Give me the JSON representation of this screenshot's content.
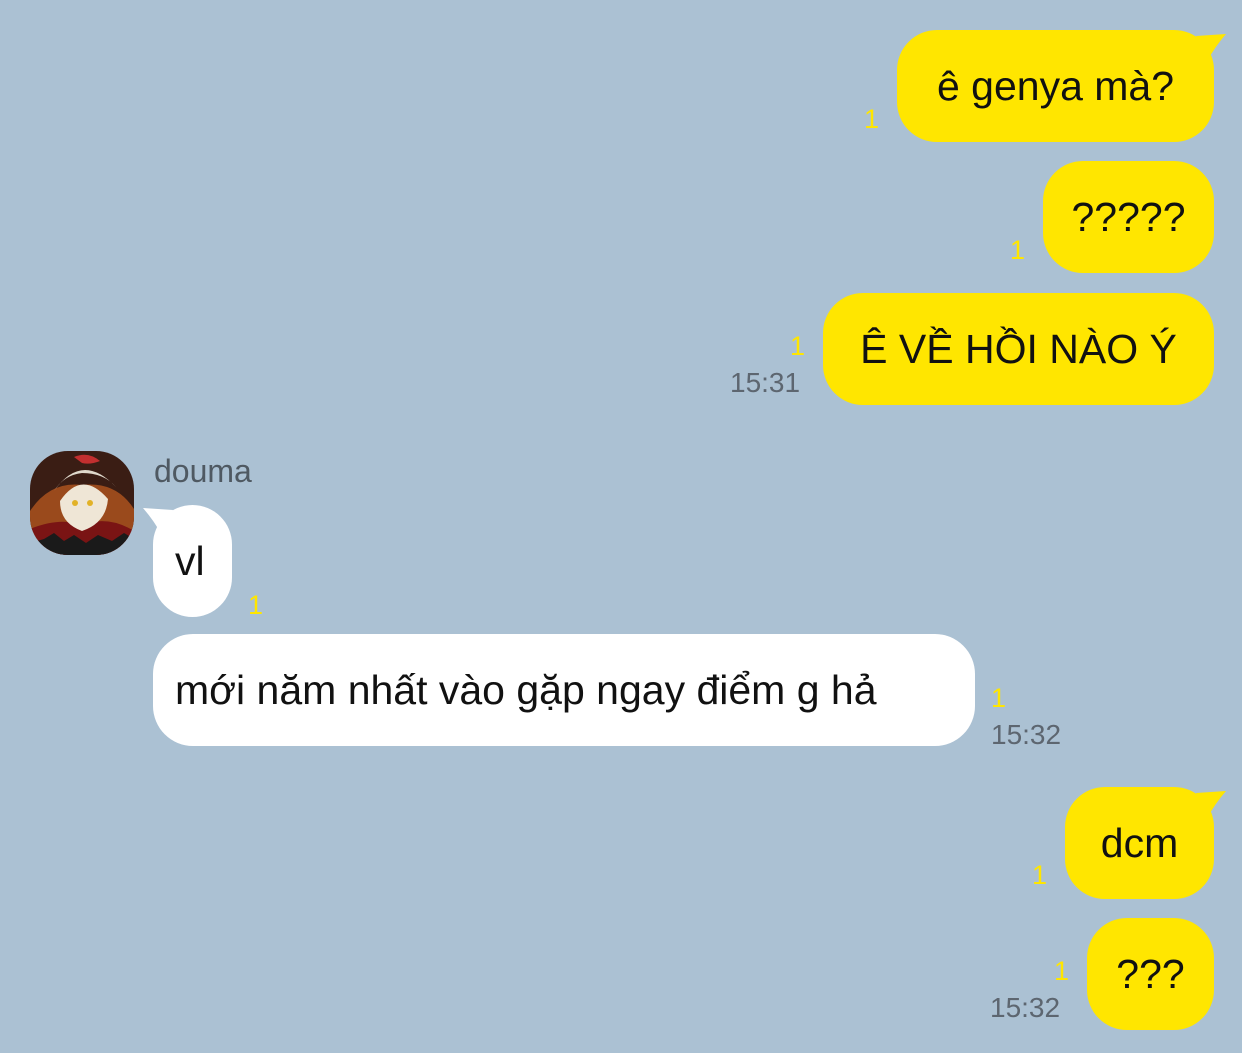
{
  "chat": {
    "outgoing_color": "#ffe600",
    "incoming_color": "#ffffff",
    "background_color": "#abc1d3",
    "read_indicator_color": "#ffe600",
    "messages": [
      {
        "direction": "out",
        "text": "ê genya mà?",
        "read_count": "1"
      },
      {
        "direction": "out",
        "text": "?????",
        "read_count": "1"
      },
      {
        "direction": "out",
        "text": "Ê VỀ HỒI NÀO Ý",
        "read_count": "1",
        "time": "15:31"
      },
      {
        "direction": "in",
        "sender": "douma",
        "text": "vl",
        "read_count": "1"
      },
      {
        "direction": "in",
        "text": "mới năm nhất vào gặp ngay điểm g hả",
        "read_count": "1",
        "time": "15:32"
      },
      {
        "direction": "out",
        "text": "dcm",
        "read_count": "1"
      },
      {
        "direction": "out",
        "text": "???",
        "read_count": "1",
        "time": "15:32"
      }
    ],
    "sender_avatar_icon": "avatar-image"
  }
}
